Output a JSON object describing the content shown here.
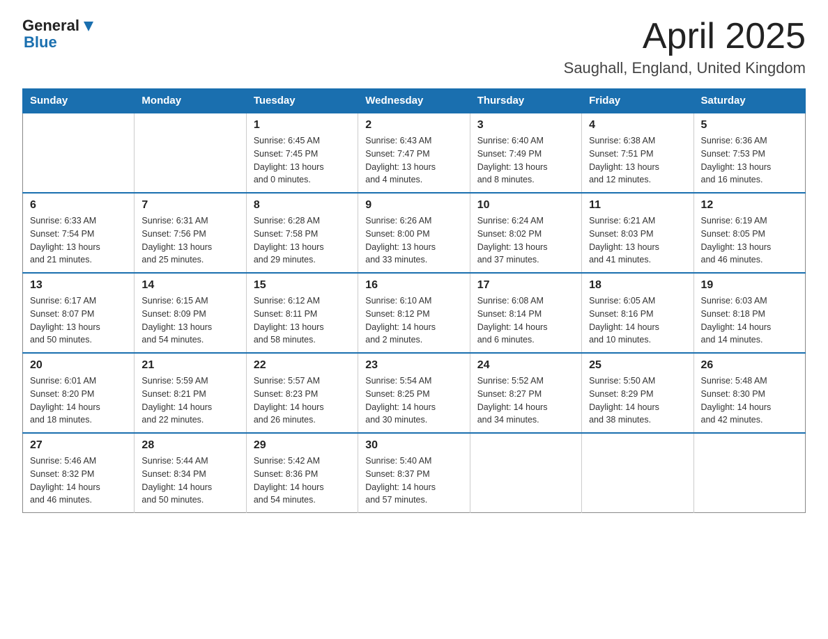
{
  "header": {
    "title": "April 2025",
    "subtitle": "Saughall, England, United Kingdom"
  },
  "logo": {
    "general": "General",
    "blue": "Blue"
  },
  "calendar": {
    "days_of_week": [
      "Sunday",
      "Monday",
      "Tuesday",
      "Wednesday",
      "Thursday",
      "Friday",
      "Saturday"
    ],
    "weeks": [
      [
        {
          "day": "",
          "info": ""
        },
        {
          "day": "",
          "info": ""
        },
        {
          "day": "1",
          "info": "Sunrise: 6:45 AM\nSunset: 7:45 PM\nDaylight: 13 hours\nand 0 minutes."
        },
        {
          "day": "2",
          "info": "Sunrise: 6:43 AM\nSunset: 7:47 PM\nDaylight: 13 hours\nand 4 minutes."
        },
        {
          "day": "3",
          "info": "Sunrise: 6:40 AM\nSunset: 7:49 PM\nDaylight: 13 hours\nand 8 minutes."
        },
        {
          "day": "4",
          "info": "Sunrise: 6:38 AM\nSunset: 7:51 PM\nDaylight: 13 hours\nand 12 minutes."
        },
        {
          "day": "5",
          "info": "Sunrise: 6:36 AM\nSunset: 7:53 PM\nDaylight: 13 hours\nand 16 minutes."
        }
      ],
      [
        {
          "day": "6",
          "info": "Sunrise: 6:33 AM\nSunset: 7:54 PM\nDaylight: 13 hours\nand 21 minutes."
        },
        {
          "day": "7",
          "info": "Sunrise: 6:31 AM\nSunset: 7:56 PM\nDaylight: 13 hours\nand 25 minutes."
        },
        {
          "day": "8",
          "info": "Sunrise: 6:28 AM\nSunset: 7:58 PM\nDaylight: 13 hours\nand 29 minutes."
        },
        {
          "day": "9",
          "info": "Sunrise: 6:26 AM\nSunset: 8:00 PM\nDaylight: 13 hours\nand 33 minutes."
        },
        {
          "day": "10",
          "info": "Sunrise: 6:24 AM\nSunset: 8:02 PM\nDaylight: 13 hours\nand 37 minutes."
        },
        {
          "day": "11",
          "info": "Sunrise: 6:21 AM\nSunset: 8:03 PM\nDaylight: 13 hours\nand 41 minutes."
        },
        {
          "day": "12",
          "info": "Sunrise: 6:19 AM\nSunset: 8:05 PM\nDaylight: 13 hours\nand 46 minutes."
        }
      ],
      [
        {
          "day": "13",
          "info": "Sunrise: 6:17 AM\nSunset: 8:07 PM\nDaylight: 13 hours\nand 50 minutes."
        },
        {
          "day": "14",
          "info": "Sunrise: 6:15 AM\nSunset: 8:09 PM\nDaylight: 13 hours\nand 54 minutes."
        },
        {
          "day": "15",
          "info": "Sunrise: 6:12 AM\nSunset: 8:11 PM\nDaylight: 13 hours\nand 58 minutes."
        },
        {
          "day": "16",
          "info": "Sunrise: 6:10 AM\nSunset: 8:12 PM\nDaylight: 14 hours\nand 2 minutes."
        },
        {
          "day": "17",
          "info": "Sunrise: 6:08 AM\nSunset: 8:14 PM\nDaylight: 14 hours\nand 6 minutes."
        },
        {
          "day": "18",
          "info": "Sunrise: 6:05 AM\nSunset: 8:16 PM\nDaylight: 14 hours\nand 10 minutes."
        },
        {
          "day": "19",
          "info": "Sunrise: 6:03 AM\nSunset: 8:18 PM\nDaylight: 14 hours\nand 14 minutes."
        }
      ],
      [
        {
          "day": "20",
          "info": "Sunrise: 6:01 AM\nSunset: 8:20 PM\nDaylight: 14 hours\nand 18 minutes."
        },
        {
          "day": "21",
          "info": "Sunrise: 5:59 AM\nSunset: 8:21 PM\nDaylight: 14 hours\nand 22 minutes."
        },
        {
          "day": "22",
          "info": "Sunrise: 5:57 AM\nSunset: 8:23 PM\nDaylight: 14 hours\nand 26 minutes."
        },
        {
          "day": "23",
          "info": "Sunrise: 5:54 AM\nSunset: 8:25 PM\nDaylight: 14 hours\nand 30 minutes."
        },
        {
          "day": "24",
          "info": "Sunrise: 5:52 AM\nSunset: 8:27 PM\nDaylight: 14 hours\nand 34 minutes."
        },
        {
          "day": "25",
          "info": "Sunrise: 5:50 AM\nSunset: 8:29 PM\nDaylight: 14 hours\nand 38 minutes."
        },
        {
          "day": "26",
          "info": "Sunrise: 5:48 AM\nSunset: 8:30 PM\nDaylight: 14 hours\nand 42 minutes."
        }
      ],
      [
        {
          "day": "27",
          "info": "Sunrise: 5:46 AM\nSunset: 8:32 PM\nDaylight: 14 hours\nand 46 minutes."
        },
        {
          "day": "28",
          "info": "Sunrise: 5:44 AM\nSunset: 8:34 PM\nDaylight: 14 hours\nand 50 minutes."
        },
        {
          "day": "29",
          "info": "Sunrise: 5:42 AM\nSunset: 8:36 PM\nDaylight: 14 hours\nand 54 minutes."
        },
        {
          "day": "30",
          "info": "Sunrise: 5:40 AM\nSunset: 8:37 PM\nDaylight: 14 hours\nand 57 minutes."
        },
        {
          "day": "",
          "info": ""
        },
        {
          "day": "",
          "info": ""
        },
        {
          "day": "",
          "info": ""
        }
      ]
    ]
  }
}
